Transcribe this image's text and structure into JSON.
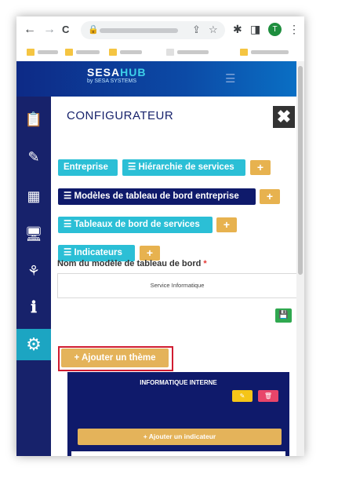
{
  "browser": {
    "nav": {
      "back_icon": "←",
      "forward_icon": "→",
      "reload_icon": "C"
    },
    "omnibox_icons": {
      "lock": "🔒",
      "share": "⇪",
      "star": "☆"
    },
    "toolbar_icons": {
      "extensions": "✱",
      "sidepanel": "◨",
      "menu": "⋮"
    },
    "profile_initial": "T"
  },
  "app": {
    "logo": {
      "sesa": "SESA",
      "hub": "HUB",
      "tagline": "by SESA SYSTEMS"
    },
    "hamburger_icon": "☰",
    "sidebar_icons": [
      "📋",
      "✎",
      "▦",
      "🖥",
      "⚘",
      "ℹ",
      "⚙"
    ],
    "title": "CONFIGURATEUR",
    "close_icon": "✖",
    "buttons": {
      "entreprise": "Entreprise",
      "hierarchie": "☰  Hiérarchie de services",
      "modeles": "☰  Modèles de tableau de bord entreprise",
      "tableaux": "☰  Tableaux de bord de services",
      "indicateurs": "☰  Indicateurs",
      "plus": "+"
    },
    "form": {
      "label": "Nom du modèle de tableau de bord",
      "required_mark": "*",
      "value": "Service Informatique",
      "save_icon": "💾"
    },
    "add_theme": "+ Ajouter un thème",
    "theme": {
      "title": "INFORMATIQUE INTERNE",
      "edit_icon": "✎",
      "delete_icon": "🗑",
      "add_indicator": "+ Ajouter un indicateur"
    }
  },
  "colors": {
    "navy": "#0f1a6b",
    "cyan": "#2bbfd6",
    "orange": "#e4b35a",
    "highlight": "#d01c30"
  }
}
